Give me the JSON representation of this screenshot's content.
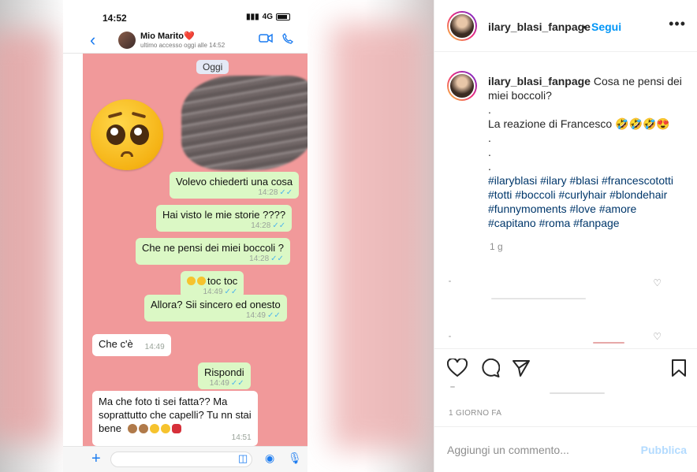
{
  "phone": {
    "status_time": "14:52",
    "network": "4G",
    "contact_name": "Mio Marito❤️",
    "last_seen": "ultimo accesso oggi alle 14:52",
    "day_divider": "Oggi",
    "messages": [
      {
        "text": "Volevo chiederti una cosa",
        "time": "14:28",
        "ticks": "✓✓",
        "dir": "out"
      },
      {
        "text": "Hai visto le mie storie ????",
        "time": "14:28",
        "ticks": "✓✓",
        "dir": "out"
      },
      {
        "text": "Che ne pensi dei miei boccoli ?",
        "time": "14:28",
        "ticks": "✓✓",
        "dir": "out"
      },
      {
        "text": "toc toc",
        "time": "14:49",
        "ticks": "✓✓",
        "dir": "out"
      },
      {
        "text": "Allora? Sii sincero ed onesto",
        "time": "14:49",
        "ticks": "✓✓",
        "dir": "out"
      },
      {
        "text": "Che c'è",
        "time": "14:49",
        "dir": "in"
      },
      {
        "text": "Rispondi",
        "time": "14:49",
        "ticks": "✓✓",
        "dir": "out"
      },
      {
        "text": "Ma che foto ti sei fatta?? Ma",
        "text2": "soprattutto che capelli? Tu nn stai",
        "text3": "bene",
        "time": "14:51",
        "dir": "in"
      }
    ]
  },
  "post": {
    "username": "ilary_blasi_fanpage",
    "separator": "•",
    "follow_label": "Segui",
    "more_icon": "•••",
    "caption_user": "ilary_blasi_fanpage",
    "caption_line1": "Cosa ne pensi dei",
    "caption_line2": "miei boccoli?",
    "caption_dot": ".",
    "caption_line3": "La reazione di Francesco 🤣🤣🤣😍",
    "tags_line1": "#ilaryblasi #ilary #blasi #francescototti",
    "tags_line2": "#totti #boccoli #curlyhair #blondehair",
    "tags_line3": "#funnymoments #love #amore",
    "tags_line4": "#capitano #roma #fanpage",
    "age": "1 g",
    "time_ago": "1 GIORNO FA",
    "add_comment_placeholder": "Aggiungi un commento...",
    "publish_label": "Pubblica"
  },
  "colors": {
    "accent": "#0095f6",
    "chat_bg": "#f1999a",
    "bubble_out": "#dbf8c5"
  }
}
